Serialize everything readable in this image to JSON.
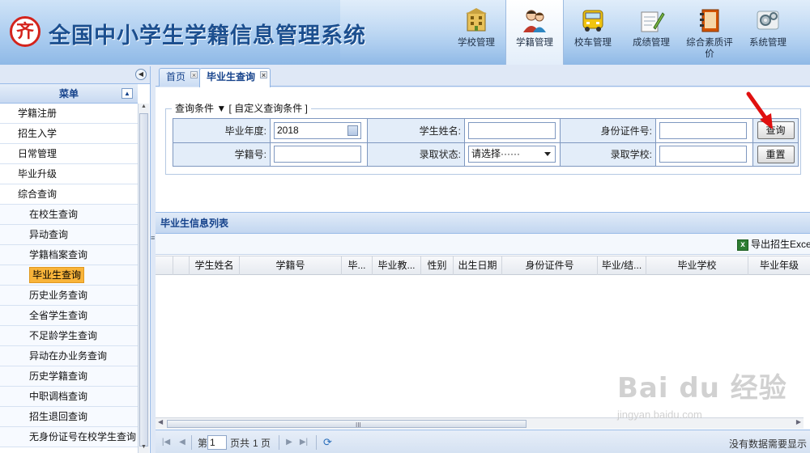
{
  "app": {
    "title": "全国中小学生学籍信息管理系统",
    "logo_glyph": "齐"
  },
  "topnav": [
    {
      "label": "学校管理",
      "icon": "building-icon"
    },
    {
      "label": "学籍管理",
      "icon": "students-icon"
    },
    {
      "label": "校车管理",
      "icon": "school-bus-icon"
    },
    {
      "label": "成绩管理",
      "icon": "grade-edit-icon"
    },
    {
      "label": "综合素质评价",
      "icon": "notebook-icon"
    },
    {
      "label": "系统管理",
      "icon": "gears-icon"
    }
  ],
  "sidebar": {
    "menu_title": "菜单",
    "items": [
      {
        "label": "学籍注册",
        "level": 1
      },
      {
        "label": "招生入学",
        "level": 1
      },
      {
        "label": "日常管理",
        "level": 1
      },
      {
        "label": "毕业升级",
        "level": 1
      },
      {
        "label": "综合查询",
        "level": 1
      },
      {
        "label": "在校生查询",
        "level": 2
      },
      {
        "label": "异动查询",
        "level": 2
      },
      {
        "label": "学籍档案查询",
        "level": 2
      },
      {
        "label": "毕业生查询",
        "level": 2,
        "selected": true
      },
      {
        "label": "历史业务查询",
        "level": 2
      },
      {
        "label": "全省学生查询",
        "level": 2
      },
      {
        "label": "不足龄学生查询",
        "level": 2
      },
      {
        "label": "异动在办业务查询",
        "level": 2
      },
      {
        "label": "历史学籍查询",
        "level": 2
      },
      {
        "label": "中职调档查询",
        "level": 2
      },
      {
        "label": "招生退回查询",
        "level": 2
      },
      {
        "label": "无身份证号在校学生查询",
        "level": 2
      }
    ]
  },
  "tabs": [
    {
      "label": "首页",
      "active": false
    },
    {
      "label": "毕业生查询",
      "active": true
    }
  ],
  "query": {
    "legend": "查询条件 ▼ [ 自定义查询条件 ]",
    "grad_year_label": "毕业年度:",
    "grad_year_value": "2018",
    "student_name_label": "学生姓名:",
    "student_name_value": "",
    "id_number_label": "身份证件号:",
    "id_number_value": "",
    "student_no_label": "学籍号:",
    "student_no_value": "",
    "admission_status_label": "录取状态:",
    "admission_status_value": "请选择······",
    "admission_school_label": "录取学校:",
    "admission_school_value": "",
    "search_button": "查询",
    "reset_button": "重置"
  },
  "grid": {
    "title": "毕业生信息列表",
    "export_label": "导出招生Exce",
    "columns": [
      "学生姓名",
      "学籍号",
      "毕...",
      "毕业教...",
      "性别",
      "出生日期",
      "身份证件号",
      "毕业/结...",
      "毕业学校",
      "毕业年级"
    ],
    "rows": []
  },
  "pager": {
    "page_prefix": "第",
    "page_value": "1",
    "page_suffix": "页共",
    "total_pages": "1 页",
    "status": "没有数据需要显示"
  },
  "watermark": {
    "logo": "Bai du 经验",
    "url": "jingyan.baidu.com"
  },
  "colors": {
    "accent": "#15428b",
    "highlight": "#f9b43a",
    "arrow": "#e01010"
  }
}
